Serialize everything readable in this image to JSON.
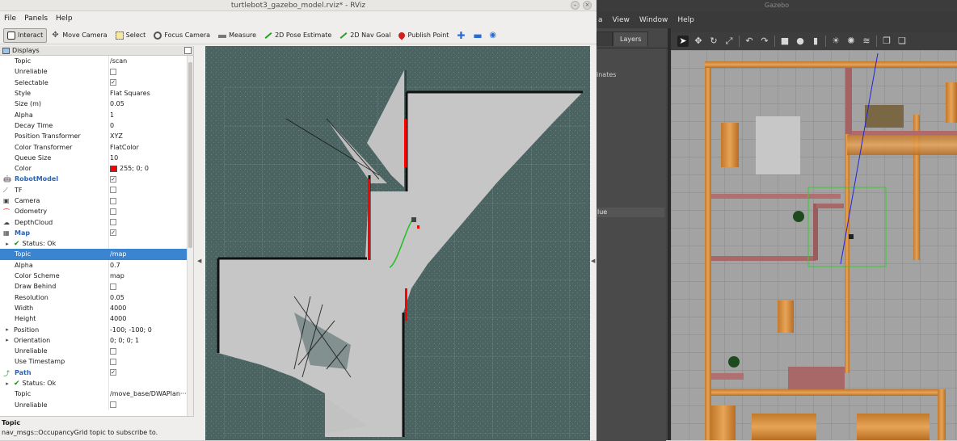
{
  "rviz": {
    "title": "turtlebot3_gazebo_model.rviz* - RViz",
    "menu": [
      "File",
      "Panels",
      "Help"
    ],
    "tools": [
      {
        "label": "Interact",
        "icon": "hand-icon",
        "active": true
      },
      {
        "label": "Move Camera",
        "icon": "move-icon"
      },
      {
        "label": "Select",
        "icon": "select-icon"
      },
      {
        "label": "Focus Camera",
        "icon": "focus-icon"
      },
      {
        "label": "Measure",
        "icon": "ruler-icon"
      },
      {
        "label": "2D Pose Estimate",
        "icon": "pose-arrow-icon"
      },
      {
        "label": "2D Nav Goal",
        "icon": "goal-arrow-icon"
      },
      {
        "label": "Publish Point",
        "icon": "pin-icon"
      }
    ],
    "displays_title": "Displays",
    "rows": [
      {
        "indent": 1,
        "key": "Topic",
        "value": "/scan"
      },
      {
        "indent": 1,
        "key": "Unreliable",
        "check": ""
      },
      {
        "indent": 1,
        "key": "Selectable",
        "check": "✓"
      },
      {
        "indent": 1,
        "key": "Style",
        "value": "Flat Squares"
      },
      {
        "indent": 1,
        "key": "Size (m)",
        "value": "0.05"
      },
      {
        "indent": 1,
        "key": "Alpha",
        "value": "1"
      },
      {
        "indent": 1,
        "key": "Decay Time",
        "value": "0"
      },
      {
        "indent": 1,
        "key": "Position Transformer",
        "value": "XYZ"
      },
      {
        "indent": 1,
        "key": "Color Transformer",
        "value": "FlatColor"
      },
      {
        "indent": 1,
        "key": "Queue Size",
        "value": "10"
      },
      {
        "indent": 1,
        "key": "Color",
        "value": "255; 0; 0",
        "swatch": "#ff0000"
      },
      {
        "indent": 0,
        "key": "RobotModel",
        "check": "✓",
        "blue": true,
        "icon": "robot-icon"
      },
      {
        "indent": 0,
        "key": "TF",
        "check": "",
        "icon": "tf-icon"
      },
      {
        "indent": 0,
        "key": "Camera",
        "check": "",
        "icon": "camera-icon"
      },
      {
        "indent": 0,
        "key": "Odometry",
        "check": "",
        "icon": "odometry-icon"
      },
      {
        "indent": 0,
        "key": "DepthCloud",
        "check": "",
        "icon": "depthcloud-icon"
      },
      {
        "indent": 0,
        "key": "Map",
        "check": "✓",
        "blue": true,
        "icon": "map-icon"
      },
      {
        "indent": 2,
        "key": "Status: Ok",
        "status": true,
        "arrow": "▸"
      },
      {
        "indent": 1,
        "key": "Topic",
        "value": "/map",
        "selected": true
      },
      {
        "indent": 1,
        "key": "Alpha",
        "value": "0.7"
      },
      {
        "indent": 1,
        "key": "Color Scheme",
        "value": "map"
      },
      {
        "indent": 1,
        "key": "Draw Behind",
        "check": ""
      },
      {
        "indent": 1,
        "key": "Resolution",
        "value": "0.05"
      },
      {
        "indent": 1,
        "key": "Width",
        "value": "4000"
      },
      {
        "indent": 1,
        "key": "Height",
        "value": "4000"
      },
      {
        "indent": 2,
        "key": "Position",
        "value": "-100; -100; 0",
        "arrow": "▸"
      },
      {
        "indent": 2,
        "key": "Orientation",
        "value": "0; 0; 0; 1",
        "arrow": "▸"
      },
      {
        "indent": 1,
        "key": "Unreliable",
        "check": ""
      },
      {
        "indent": 1,
        "key": "Use Timestamp",
        "check": ""
      },
      {
        "indent": 0,
        "key": "Path",
        "check": "✓",
        "blue": true,
        "icon": "path-icon"
      },
      {
        "indent": 2,
        "key": "Status: Ok",
        "status": true,
        "arrow": "▸"
      },
      {
        "indent": 1,
        "key": "Topic",
        "value": "/move_base/DWAPlan···"
      },
      {
        "indent": 1,
        "key": "Unreliable",
        "check": ""
      }
    ],
    "help_title": "Topic",
    "help_text": "nav_msgs::OccupancyGrid topic to subscribe to."
  },
  "gazebo": {
    "title": "Gazebo",
    "menu": [
      "a",
      "View",
      "Window",
      "Help"
    ],
    "tabs": [
      "",
      "Layers"
    ],
    "left_label1": "inates",
    "left_label2": "lue"
  },
  "colors": {
    "laser": "#ff0000",
    "map_free": "#c4c4c4",
    "map_unknown": "#4b6462",
    "path": "#22c022"
  }
}
